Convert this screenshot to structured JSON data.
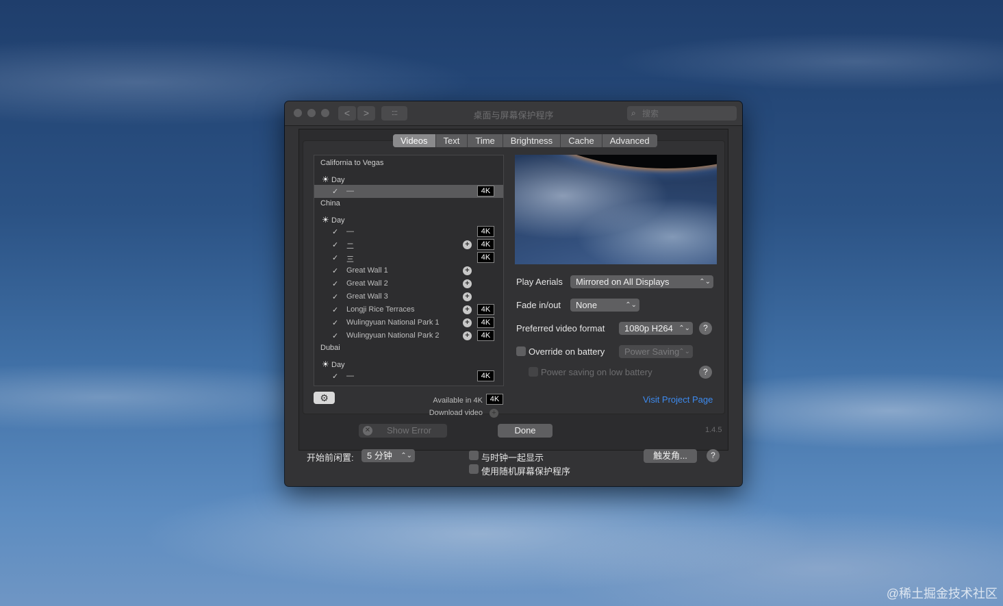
{
  "window": {
    "title": "桌面与屏幕保护程序",
    "search_placeholder": "搜索",
    "nav_back": "<",
    "nav_forward": ">",
    "grid_icon": "::::"
  },
  "tabs": [
    "Videos",
    "Text",
    "Time",
    "Brightness",
    "Cache",
    "Advanced"
  ],
  "active_tab": "Videos",
  "video_list": {
    "groups": [
      {
        "name": "California to Vegas",
        "time": "Day",
        "videos": [
          {
            "name": "—",
            "checked": true,
            "plus": false,
            "is4k": true,
            "selected": true
          }
        ]
      },
      {
        "name": "China",
        "time": "Day",
        "videos": [
          {
            "name": "—",
            "checked": true,
            "plus": false,
            "is4k": true
          },
          {
            "name": "二",
            "checked": true,
            "plus": true,
            "is4k": true
          },
          {
            "name": "三",
            "checked": true,
            "plus": false,
            "is4k": true
          },
          {
            "name": "Great Wall 1",
            "checked": true,
            "plus": true,
            "is4k": false
          },
          {
            "name": "Great Wall 2",
            "checked": true,
            "plus": true,
            "is4k": false
          },
          {
            "name": "Great Wall 3",
            "checked": true,
            "plus": true,
            "is4k": false
          },
          {
            "name": "Longji Rice Terraces",
            "checked": true,
            "plus": true,
            "is4k": true
          },
          {
            "name": "Wulingyuan National Park 1",
            "checked": true,
            "plus": true,
            "is4k": true
          },
          {
            "name": "Wulingyuan National Park 2",
            "checked": true,
            "plus": true,
            "is4k": true
          }
        ]
      },
      {
        "name": "Dubai",
        "time": "Day",
        "videos": [
          {
            "name": "—",
            "checked": true,
            "plus": false,
            "is4k": true
          }
        ]
      }
    ],
    "badge_4k": "4K",
    "checkmark": "✓",
    "sun_icon": "☀",
    "plus_icon": "+",
    "available_label": "Available in 4K",
    "available_badge": "4K",
    "download_label": "Download video",
    "gear_icon": "⚙"
  },
  "settings": {
    "play_aerials_label": "Play Aerials",
    "play_aerials_value": "Mirrored on All Displays",
    "fade_label": "Fade in/out",
    "fade_value": "None",
    "format_label": "Preferred video format",
    "format_value": "1080p H264",
    "override_label": "Override on battery",
    "override_value": "Power Saving",
    "lowbattery_label": "Power saving on low battery",
    "help": "?",
    "popup_arrow": "⌃⌄",
    "visit_link": "Visit Project Page"
  },
  "footer": {
    "show_error": "Show Error",
    "show_error_icon": "✕",
    "done": "Done",
    "version": "1.4.5"
  },
  "bottom": {
    "idle_label": "开始前闲置:",
    "idle_value": "5 分钟",
    "clock_label": "与时钟一起显示",
    "random_label": "使用随机屏幕保护程序",
    "hot_corners": "触发角...",
    "help": "?"
  },
  "watermark": "@稀土掘金技术社区"
}
